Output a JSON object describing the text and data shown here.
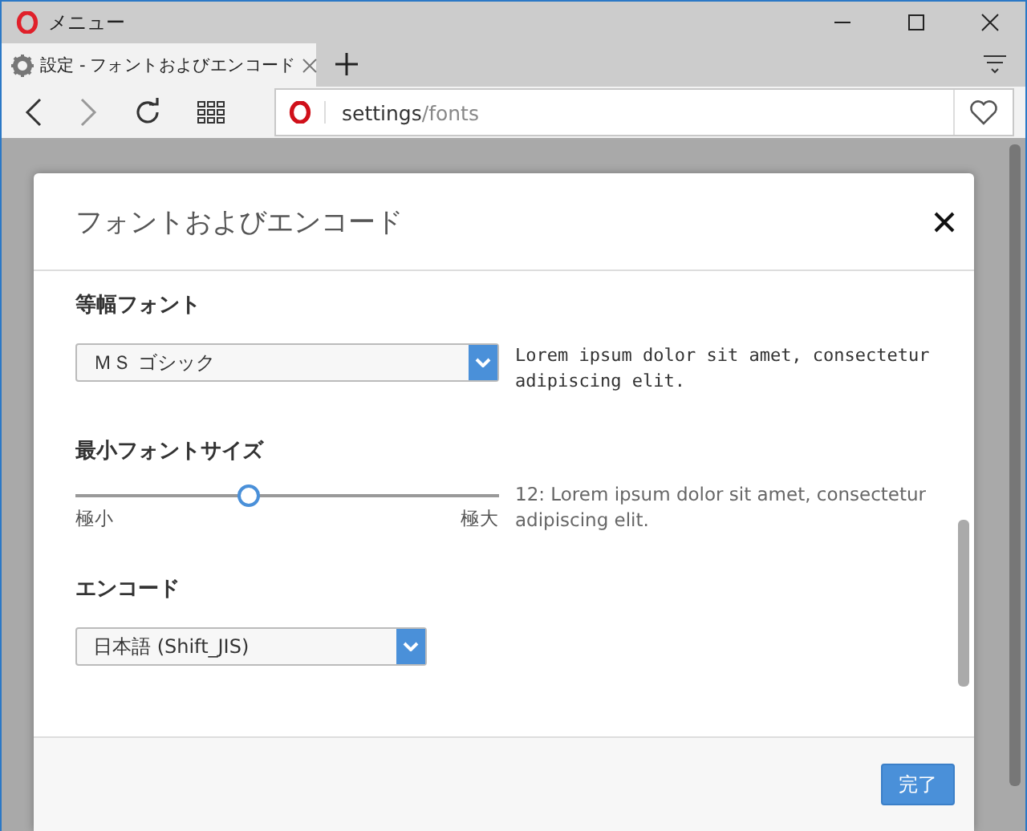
{
  "window": {
    "title": "メニュー"
  },
  "tabs": [
    {
      "label": "設定 - フォントおよびエンコード",
      "selected": true
    }
  ],
  "address_bar": {
    "host": "settings",
    "path": "/fonts"
  },
  "dialog": {
    "title": "フォントおよびエンコード",
    "sections": [
      {
        "kind": "select",
        "heading": "等幅フォント",
        "value": "ＭＳ ゴシック",
        "preview": "Lorem ipsum dolor sit amet, consectetur adipiscing elit."
      },
      {
        "kind": "slider",
        "heading": "最小フォントサイズ",
        "level": 0.41,
        "min_label": "極小",
        "max_label": "極大",
        "preview": "12: Lorem ipsum dolor sit amet, consectetur adipiscing elit."
      },
      {
        "kind": "select",
        "heading": "エンコード",
        "value": "日本語 (Shift_JIS)"
      }
    ],
    "done_button": "完了"
  }
}
